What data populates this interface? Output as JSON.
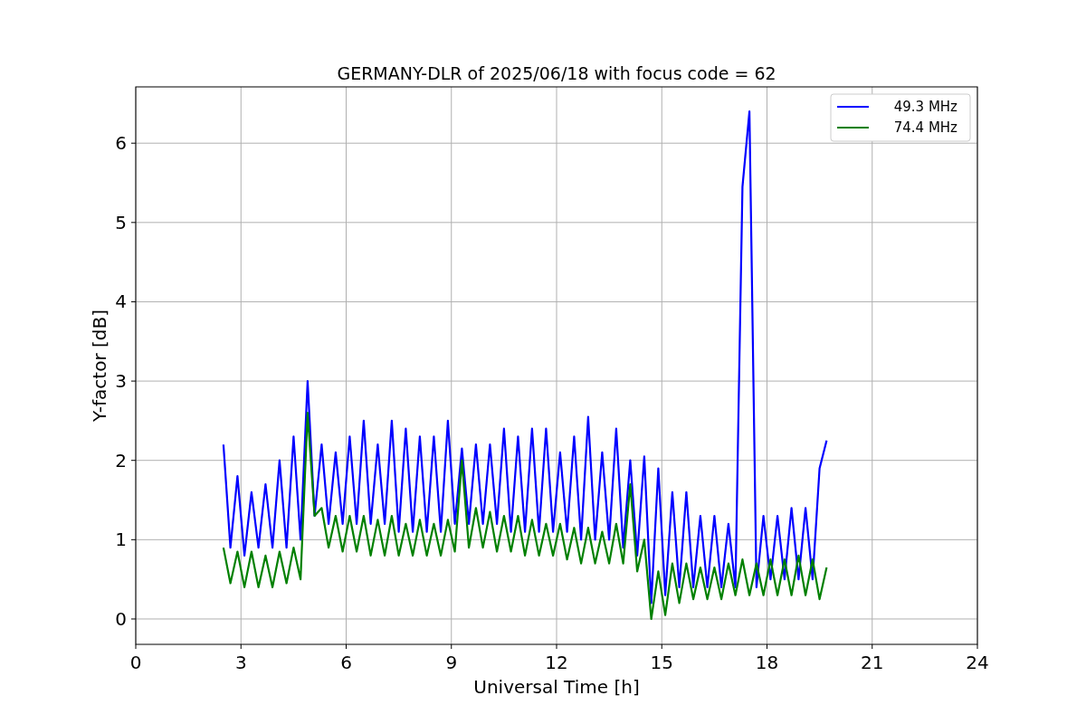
{
  "chart_data": {
    "type": "line",
    "title": "GERMANY-DLR of 2025/06/18 with focus code = 62",
    "xlabel": "Universal Time [h]",
    "ylabel": "Y-factor [dB]",
    "grid": true,
    "legend": true,
    "xlim": [
      0,
      24
    ],
    "ylim": [
      -0.32,
      6.71
    ],
    "xticks": [
      0,
      3,
      6,
      9,
      12,
      15,
      18,
      21,
      24
    ],
    "yticks": [
      0,
      1,
      2,
      3,
      4,
      5,
      6
    ],
    "x": [
      2.5,
      2.7,
      2.9,
      3.1,
      3.3,
      3.5,
      3.7,
      3.9,
      4.1,
      4.3,
      4.5,
      4.7,
      4.9,
      5.1,
      5.3,
      5.5,
      5.7,
      5.9,
      6.1,
      6.3,
      6.5,
      6.7,
      6.9,
      7.1,
      7.3,
      7.5,
      7.7,
      7.9,
      8.1,
      8.3,
      8.5,
      8.7,
      8.9,
      9.1,
      9.3,
      9.5,
      9.7,
      9.9,
      10.1,
      10.3,
      10.5,
      10.7,
      10.9,
      11.1,
      11.3,
      11.5,
      11.7,
      11.9,
      12.1,
      12.3,
      12.5,
      12.7,
      12.9,
      13.1,
      13.3,
      13.5,
      13.7,
      13.9,
      14.1,
      14.3,
      14.5,
      14.7,
      14.9,
      15.1,
      15.3,
      15.5,
      15.7,
      15.9,
      16.1,
      16.3,
      16.5,
      16.7,
      16.9,
      17.1,
      17.3,
      17.5,
      17.7,
      17.9,
      18.1,
      18.3,
      18.5,
      18.7,
      18.9,
      19.1,
      19.3,
      19.5,
      19.7
    ],
    "series": [
      {
        "name": "49.3 MHz",
        "color": "#0000ff",
        "values": [
          2.2,
          0.9,
          1.8,
          0.8,
          1.6,
          0.9,
          1.7,
          0.9,
          2.0,
          0.9,
          2.3,
          1.0,
          3.0,
          1.3,
          2.2,
          1.2,
          2.1,
          1.2,
          2.3,
          1.2,
          2.5,
          1.2,
          2.2,
          1.2,
          2.5,
          1.1,
          2.4,
          1.1,
          2.3,
          1.1,
          2.3,
          1.1,
          2.5,
          1.2,
          2.15,
          1.2,
          2.2,
          1.2,
          2.2,
          1.2,
          2.4,
          1.1,
          2.3,
          1.1,
          2.4,
          1.1,
          2.4,
          1.1,
          2.1,
          1.1,
          2.3,
          1.0,
          2.55,
          1.0,
          2.1,
          1.0,
          2.4,
          0.9,
          2.0,
          0.8,
          2.05,
          0.2,
          1.9,
          0.3,
          1.6,
          0.4,
          1.6,
          0.4,
          1.3,
          0.4,
          1.3,
          0.4,
          1.2,
          0.4,
          5.45,
          6.4,
          0.4,
          1.3,
          0.5,
          1.3,
          0.5,
          1.4,
          0.5,
          1.4,
          0.5,
          1.9,
          2.25
        ]
      },
      {
        "name": "74.4 MHz",
        "color": "#008000",
        "values": [
          0.9,
          0.45,
          0.85,
          0.4,
          0.85,
          0.4,
          0.8,
          0.4,
          0.85,
          0.45,
          0.9,
          0.5,
          2.6,
          1.3,
          1.4,
          0.9,
          1.3,
          0.85,
          1.3,
          0.85,
          1.3,
          0.8,
          1.25,
          0.8,
          1.3,
          0.8,
          1.2,
          0.8,
          1.25,
          0.8,
          1.2,
          0.8,
          1.25,
          0.85,
          2.0,
          0.9,
          1.4,
          0.9,
          1.35,
          0.85,
          1.3,
          0.85,
          1.3,
          0.8,
          1.25,
          0.8,
          1.2,
          0.8,
          1.2,
          0.75,
          1.15,
          0.7,
          1.15,
          0.7,
          1.1,
          0.7,
          1.2,
          0.7,
          1.7,
          0.6,
          1.0,
          0.0,
          0.6,
          0.05,
          0.7,
          0.2,
          0.7,
          0.25,
          0.65,
          0.25,
          0.65,
          0.25,
          0.7,
          0.3,
          0.75,
          0.3,
          0.7,
          0.3,
          0.75,
          0.3,
          0.75,
          0.3,
          0.8,
          0.3,
          0.75,
          0.25,
          0.65
        ]
      }
    ]
  }
}
